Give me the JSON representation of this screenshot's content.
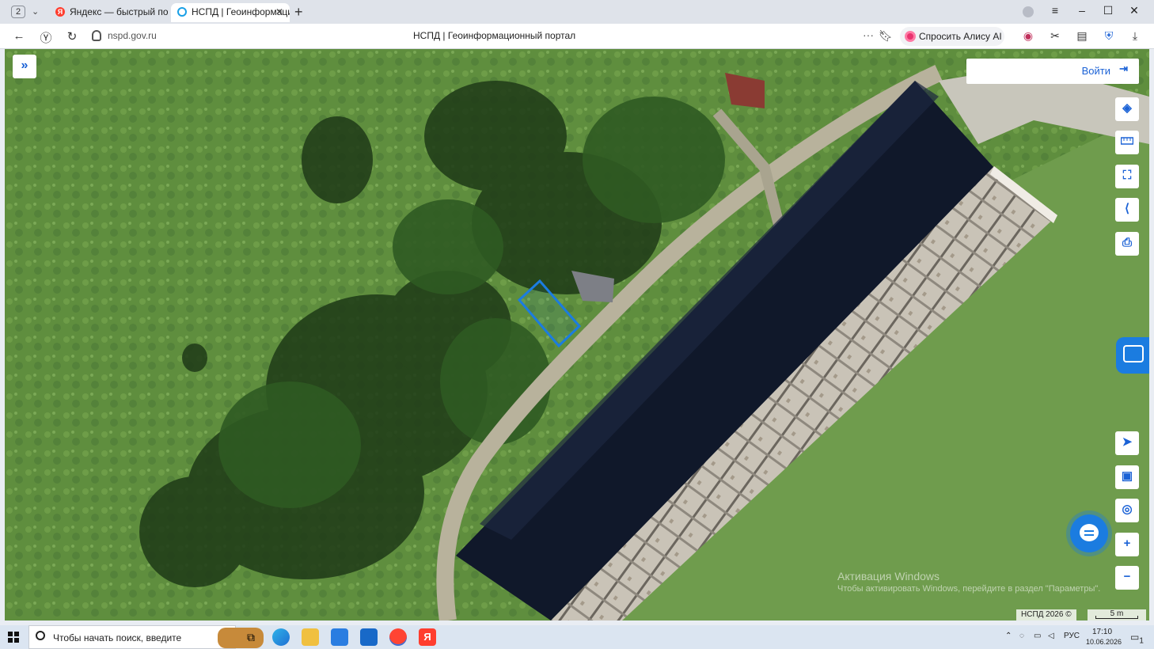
{
  "browser": {
    "tab_count": "2",
    "tabs": [
      {
        "label": "Яндекс — быстрый поиск"
      },
      {
        "label": "НСПД | Геоинформаци"
      }
    ],
    "url": "nspd.gov.ru",
    "page_title": "НСПД | Геоинформационный портал",
    "alice_button": "Спросить Алису AI",
    "icons": [
      "back-icon",
      "yandex-icon",
      "reload-icon",
      "lock-icon",
      "bookmark-icon",
      "download-icon",
      "extensions-icon"
    ]
  },
  "map": {
    "login_label": "Войти",
    "watermark_title": "Активация Windows",
    "watermark_text": "Чтобы активировать Windows, перейдите в раздел \"Параметры\".",
    "copyright": "НСПД 2026 ©",
    "scale_label": "5 m",
    "tools": [
      "layers-icon",
      "ruler-icon",
      "select-area-icon",
      "share-icon",
      "print-icon",
      "locate-icon",
      "minimap-icon",
      "geolocation-icon",
      "zoom-in-icon",
      "zoom-out-icon"
    ],
    "colors": {
      "accent": "#1b62d6",
      "parcel_outline": "#1b7ce0"
    }
  },
  "taskbar": {
    "search_placeholder": "Чтобы начать поиск, введите",
    "language": "РУС",
    "time": "17:10",
    "date": "10.06.2026",
    "notification_count": "1"
  }
}
